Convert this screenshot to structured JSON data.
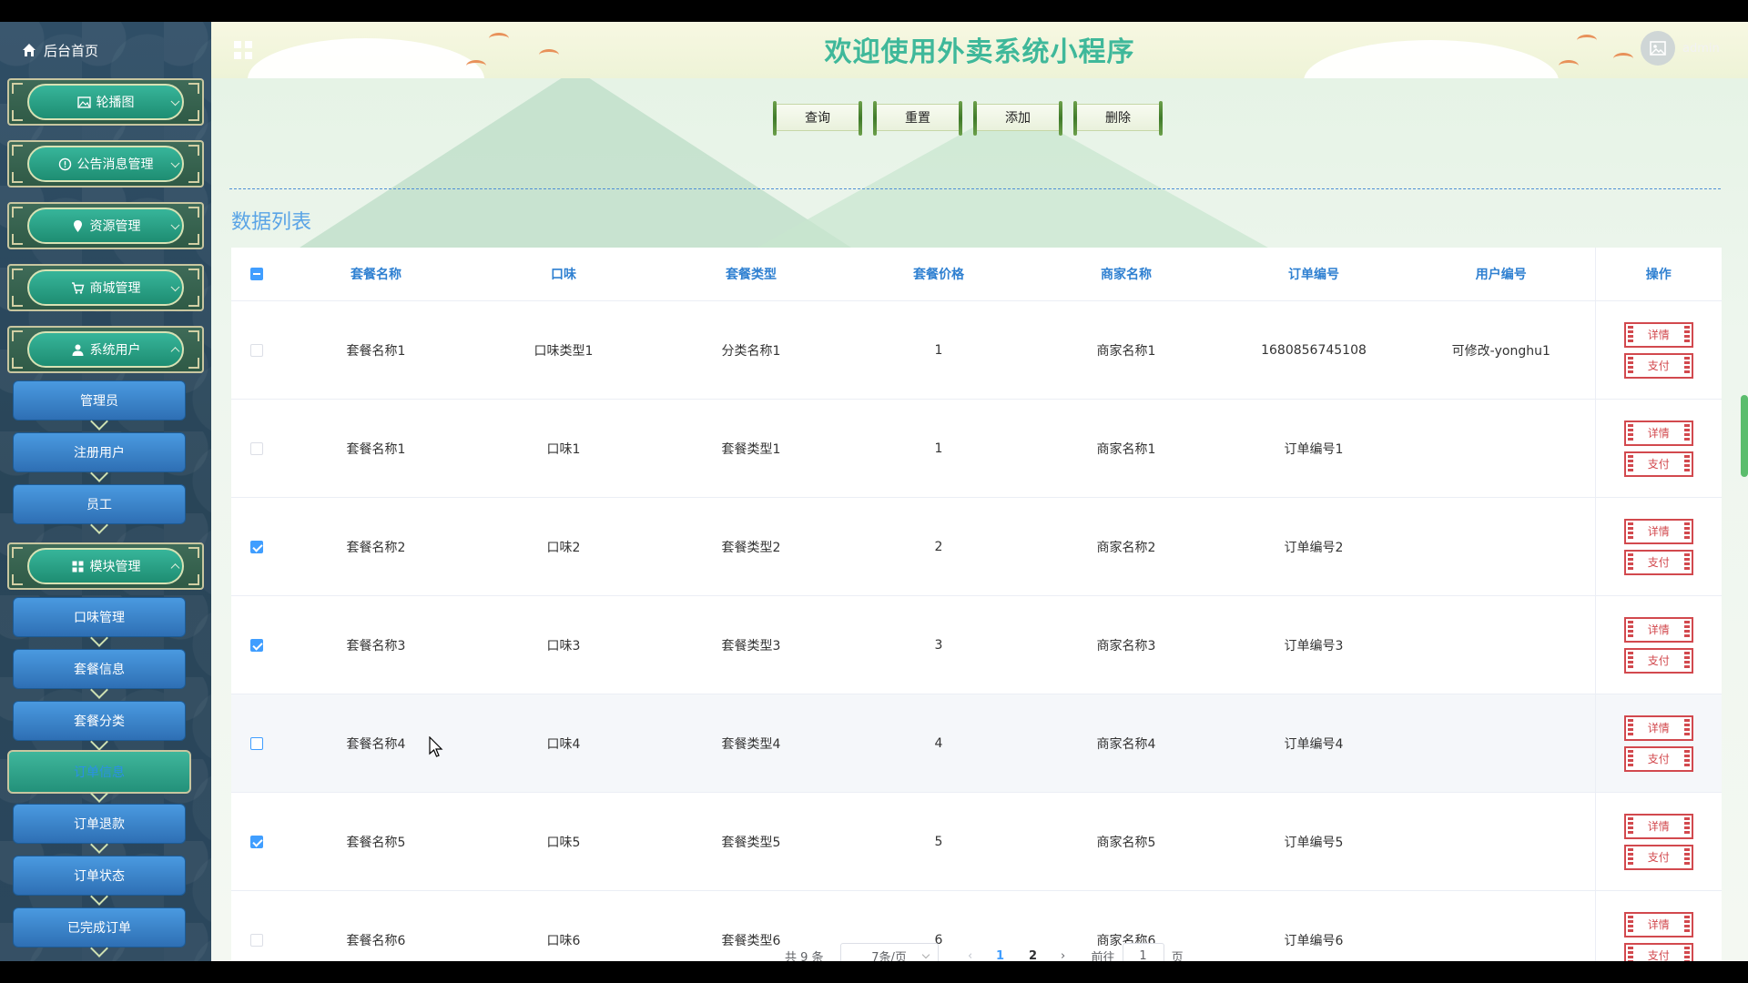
{
  "sidebar": {
    "home_label": "后台首页",
    "menus": {
      "carousel": "轮播图",
      "notice": "公告消息管理",
      "resource": "资源管理",
      "mall": "商城管理",
      "sysuser": "系统用户",
      "admin": "管理员",
      "reguser": "注册用户",
      "staff": "员工",
      "module": "模块管理",
      "flavor_mgmt": "口味管理",
      "combo_info": "套餐信息",
      "combo_category": "套餐分类",
      "order_info": "订单信息",
      "order_refund": "订单退款",
      "order_status": "订单状态",
      "completed_orders": "已完成订单"
    }
  },
  "header": {
    "title": "欢迎使用外卖系统小程序",
    "username": "admin"
  },
  "toolbar": {
    "query": "查询",
    "reset": "重置",
    "add": "添加",
    "delete": "删除"
  },
  "list_title": "数据列表",
  "table": {
    "columns": {
      "name": "套餐名称",
      "flavor": "口味",
      "type": "套餐类型",
      "price": "套餐价格",
      "merchant": "商家名称",
      "order_no": "订单编号",
      "user_no": "用户编号",
      "actions": "操作"
    },
    "action_labels": {
      "detail": "详情",
      "pay": "支付"
    },
    "rows": [
      {
        "name": "套餐名称1",
        "flavor": "口味类型1",
        "type": "分类名称1",
        "price": "1",
        "merchant": "商家名称1",
        "order_no": "1680856745108",
        "user_no": "可修改-yonghu1"
      },
      {
        "name": "套餐名称1",
        "flavor": "口味1",
        "type": "套餐类型1",
        "price": "1",
        "merchant": "商家名称1",
        "order_no": "订单编号1",
        "user_no": ""
      },
      {
        "name": "套餐名称2",
        "flavor": "口味2",
        "type": "套餐类型2",
        "price": "2",
        "merchant": "商家名称2",
        "order_no": "订单编号2",
        "user_no": ""
      },
      {
        "name": "套餐名称3",
        "flavor": "口味3",
        "type": "套餐类型3",
        "price": "3",
        "merchant": "商家名称3",
        "order_no": "订单编号3",
        "user_no": ""
      },
      {
        "name": "套餐名称4",
        "flavor": "口味4",
        "type": "套餐类型4",
        "price": "4",
        "merchant": "商家名称4",
        "order_no": "订单编号4",
        "user_no": ""
      },
      {
        "name": "套餐名称5",
        "flavor": "口味5",
        "type": "套餐类型5",
        "price": "5",
        "merchant": "商家名称5",
        "order_no": "订单编号5",
        "user_no": ""
      },
      {
        "name": "套餐名称6",
        "flavor": "口味6",
        "type": "套餐类型6",
        "price": "6",
        "merchant": "商家名称6",
        "order_no": "订单编号6",
        "user_no": ""
      }
    ]
  },
  "pagination": {
    "total": "共 9 条",
    "page_size": "7条/页",
    "pages": [
      "1",
      "2"
    ],
    "goto_prefix": "前往",
    "goto_value": "1",
    "goto_suffix": "页"
  },
  "colors": {
    "title_green": "#3fb89a",
    "header_blue": "#2f80d1",
    "action_red": "#d2494e",
    "sidebar_bg": "#2f4e66"
  },
  "icons": {
    "home": "home-icon",
    "image": "image-icon",
    "info": "info-icon",
    "pin": "location-pin-icon",
    "cart": "cart-icon",
    "user": "user-icon",
    "grid": "grid-icon",
    "avatar": "avatar-image-icon"
  }
}
